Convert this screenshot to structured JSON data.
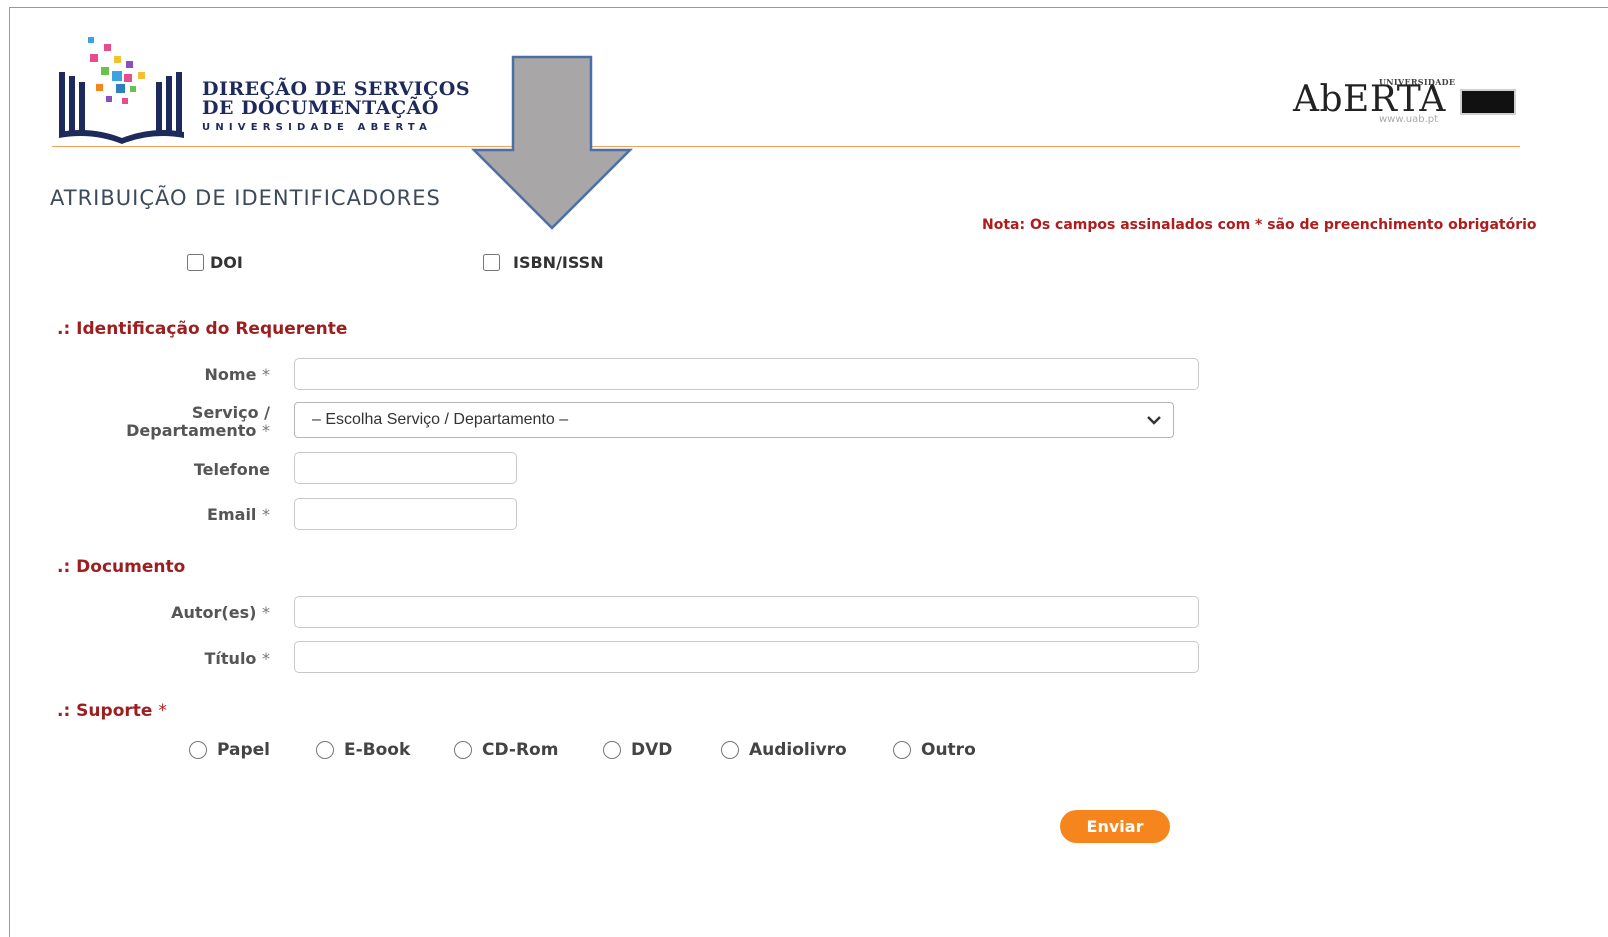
{
  "header": {
    "logo_left": {
      "line1": "DIREÇÃO DE SERVIÇOS",
      "line2": "DE DOCUMENTAÇÃO",
      "line3": "UNIVERSIDADE ABERTA"
    },
    "logo_right": {
      "small": "UNIVERSIDADE",
      "big": "AbERTA",
      "url": "www.uab.pt"
    }
  },
  "page": {
    "title": "ATRIBUIÇÃO DE IDENTIFICADORES",
    "note": "Nota: Os campos assinalados com * são de preenchimento obrigatório"
  },
  "identifiers": {
    "doi_label": "DOI",
    "isbn_label": "ISBN/ISSN"
  },
  "requester": {
    "section_title": ".: Identificação do Requerente",
    "nome_label": "Nome",
    "servico_label_1": "Serviço /",
    "servico_label_2": "Departamento",
    "servico_selected": "– Escolha Serviço / Departamento –",
    "telefone_label": "Telefone",
    "email_label": "Email",
    "star": "*"
  },
  "document": {
    "section_title": ".: Documento",
    "autores_label": "Autor(es)",
    "titulo_label": "Título"
  },
  "support": {
    "section_title": ".: Suporte",
    "options": [
      "Papel",
      "E-Book",
      "CD-Rom",
      "DVD",
      "Audiolivro",
      "Outro"
    ]
  },
  "actions": {
    "submit_label": "Enviar"
  },
  "colors": {
    "accent_orange": "#f7851e",
    "section_red": "#9c1f1f",
    "logo_navy": "#1f2a5c"
  }
}
